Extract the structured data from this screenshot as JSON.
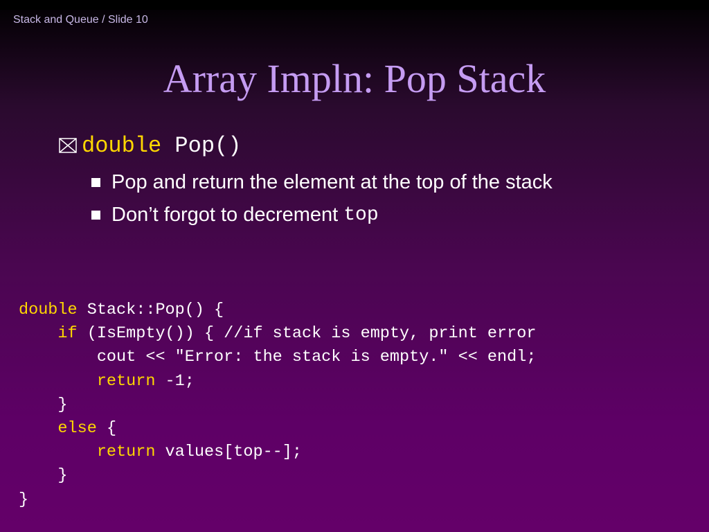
{
  "slide": {
    "header": "Stack and Queue / Slide 10",
    "title": "Array Impln: Pop Stack"
  },
  "bullet": {
    "icon": "boxed-x-icon",
    "keyword": "double",
    "text": " Pop()"
  },
  "subbullets": [
    {
      "text": "Pop and return the element at the top of the stack"
    },
    {
      "text": "Don’t forgot to decrement",
      "code": "top"
    }
  ],
  "colors": {
    "title": "#c59cf2",
    "keyword": "#ffd700",
    "text": "#ffffff",
    "header": "#c8b8e6",
    "background_top": "#000000",
    "background_bottom": "#640069"
  },
  "code": {
    "lines": [
      {
        "indent": "",
        "keyword": "double",
        "text": " Stack::Pop() {"
      },
      {
        "indent": "\t",
        "keyword": "if",
        "text": " (IsEmpty()) { //if stack is empty, print error"
      },
      {
        "indent": "\t\t",
        "keyword": "",
        "text": "cout << \"Error: the stack is empty.\" << endl;"
      },
      {
        "indent": "\t\t",
        "keyword": "return",
        "text": " -1;"
      },
      {
        "indent": "\t",
        "keyword": "",
        "text": "}"
      },
      {
        "indent": "\t",
        "keyword": "else",
        "text": " {"
      },
      {
        "indent": "\t\t",
        "keyword": "return",
        "text": " values[top--];"
      },
      {
        "indent": "\t",
        "keyword": "",
        "text": "}"
      },
      {
        "indent": "",
        "keyword": "",
        "text": "}"
      }
    ]
  }
}
